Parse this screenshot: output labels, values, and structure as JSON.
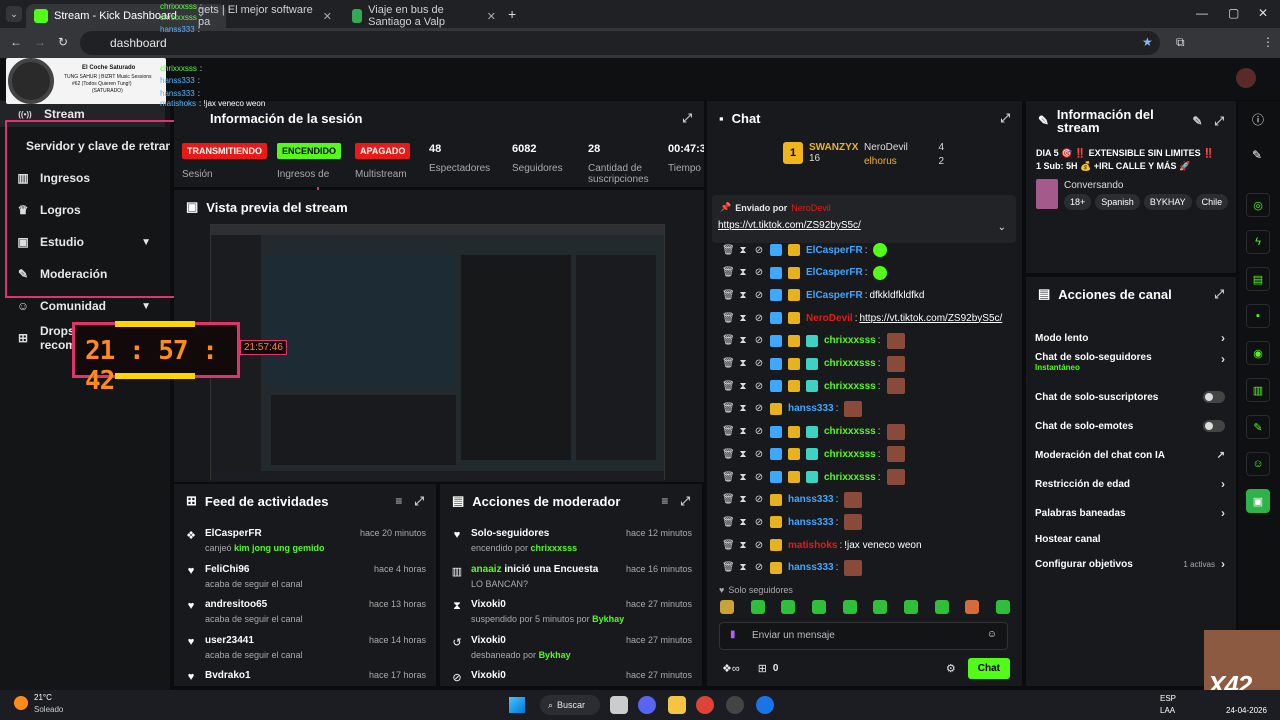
{
  "browser": {
    "tabs": [
      {
        "title": "Stream - Kick Dashboard",
        "active": true
      },
      {
        "title": "gets | El mejor software pa",
        "active": false
      },
      {
        "title": "Viaje en bus de Santiago a Valp",
        "active": false
      }
    ],
    "new_tab": "+",
    "address": "dashboard",
    "window_controls": {
      "minimize": "—",
      "maximize": "▢",
      "close": "✕"
    }
  },
  "overlay": {
    "now_playing": {
      "title": "El Coche Saturado",
      "line1": "TUNG SAHUR | BIZRT Music Sessions",
      "line2": "#62 (Todos Quieren Tung!)",
      "line3": "(SATURADO)"
    },
    "chat_lines": [
      {
        "name": "chrixxxsss",
        "green": true,
        "text": ":"
      },
      {
        "name": "chrixxxsss",
        "green": true,
        "text": ":"
      },
      {
        "name": "hanss333",
        "green": false,
        "text": ":"
      },
      {
        "name": "chrixxxsss",
        "green": true,
        "text": ":"
      },
      {
        "name": "hanss333",
        "green": false,
        "text": ":"
      },
      {
        "name": "hanss333",
        "green": false,
        "text": ":"
      },
      {
        "name": "matishoks",
        "green": false,
        "text": ": !jax veneco weon"
      }
    ],
    "timer_big": "21 : 57 : 42",
    "timer_small": "21:57:46",
    "watermark": "X42"
  },
  "sidebar": {
    "items": [
      {
        "label": "Stream",
        "icon": "broadcast-icon",
        "glyph": "((•))",
        "chevron": false
      },
      {
        "label": "Servidor y clave de retransn",
        "icon": "",
        "glyph": "",
        "chevron": false
      },
      {
        "label": "Ingresos",
        "icon": "chart-icon",
        "glyph": "▥",
        "chevron": false
      },
      {
        "label": "Logros",
        "icon": "trophy-icon",
        "glyph": "♛",
        "chevron": false
      },
      {
        "label": "Estudio",
        "icon": "studio-icon",
        "glyph": "▣",
        "chevron": true
      },
      {
        "label": "Moderación",
        "icon": "wrench-icon",
        "glyph": "✎",
        "chevron": false
      },
      {
        "label": "Comunidad",
        "icon": "community-icon",
        "glyph": "☺",
        "chevron": true
      },
      {
        "label": "Drops y recompensas",
        "icon": "gift-icon",
        "glyph": "⊞",
        "chevron": false
      }
    ]
  },
  "session": {
    "title": "Información de la sesión",
    "stats": [
      {
        "badge": "TRANSMITIENDO",
        "badge_color": "#e91916",
        "label": "Sesión"
      },
      {
        "badge": "ENCENDIDO",
        "badge_color": "#53fc18",
        "label": "Ingresos de"
      },
      {
        "badge": "APAGADO",
        "badge_color": "#e91916",
        "label": "Multistream"
      },
      {
        "value": "48",
        "label": "Espectadores"
      },
      {
        "value": "6082",
        "label": "Seguidores"
      },
      {
        "value": "28",
        "label": "Cantidad de suscripciones"
      },
      {
        "value": "00:47:3",
        "label": "Tiempo"
      }
    ]
  },
  "preview": {
    "title": "Vista previa del stream"
  },
  "feed": {
    "title": "Feed de actividades",
    "items": [
      {
        "icon": "gift-icon",
        "glyph": "❖",
        "name": "ElCasperFR",
        "time": "hace 20 minutos",
        "sub_prefix": "canjeó ",
        "sub_highlight": "kim jong ung gemido",
        "sub_suffix": ""
      },
      {
        "icon": "heart-icon",
        "glyph": "♥",
        "name": "FeliChi96",
        "time": "hace 4 horas",
        "sub_prefix": "acaba de seguir el canal",
        "sub_highlight": "",
        "sub_suffix": ""
      },
      {
        "icon": "heart-icon",
        "glyph": "♥",
        "name": "andresitoo65",
        "time": "hace 13 horas",
        "sub_prefix": "acaba de seguir el canal",
        "sub_highlight": "",
        "sub_suffix": ""
      },
      {
        "icon": "heart-icon",
        "glyph": "♥",
        "name": "user23441",
        "time": "hace 14 horas",
        "sub_prefix": "acaba de seguir el canal",
        "sub_highlight": "",
        "sub_suffix": ""
      },
      {
        "icon": "heart-icon",
        "glyph": "♥",
        "name": "Bvdrako1",
        "time": "hace 17 horas",
        "sub_prefix": "",
        "sub_highlight": "",
        "sub_suffix": ""
      }
    ]
  },
  "modactions": {
    "title": "Acciones de moderador",
    "items": [
      {
        "icon": "heart-icon",
        "glyph": "♥",
        "name": "Solo-seguidores",
        "name_hl": "",
        "time": "hace 12 minutos",
        "sub_prefix": "encendido por ",
        "sub_highlight": "chrixxxsss"
      },
      {
        "icon": "poll-icon",
        "glyph": "▥",
        "name": " inició una Encuesta",
        "name_hl": "anaaiz",
        "time": "hace 16 minutos",
        "sub_prefix": "LO BANCAN?",
        "sub_highlight": ""
      },
      {
        "icon": "hourglass-icon",
        "glyph": "⧗",
        "name": "Vixoki0",
        "name_hl": "",
        "time": "hace 27 minutos",
        "sub_prefix": "suspendido por 5 minutos por ",
        "sub_highlight": "Bykhay"
      },
      {
        "icon": "undo-icon",
        "glyph": "↺",
        "name": "Vixoki0",
        "name_hl": "",
        "time": "hace 27 minutos",
        "sub_prefix": "desbaneado por ",
        "sub_highlight": "Bykhay"
      },
      {
        "icon": "ban-icon",
        "glyph": "⊘",
        "name": "Vixoki0",
        "name_hl": "",
        "time": "hace 27 minutos",
        "sub_prefix": "",
        "sub_highlight": ""
      }
    ]
  },
  "chat": {
    "title": "Chat",
    "leaderboard": {
      "rank": "1",
      "top_name": "SWANZYX",
      "top_value": "16",
      "others": [
        {
          "name": "NeroDevil",
          "value": "4"
        },
        {
          "name": "elhorus",
          "value": "2"
        }
      ]
    },
    "pinned": {
      "label": "Enviado por",
      "by": "NeroDevil",
      "link": "https://vt.tiktok.com/ZS92byS5c/"
    },
    "messages": [
      {
        "name": "ElCasperFR",
        "color": "#3ea7ff",
        "gem": false,
        "text": "",
        "emote": "green"
      },
      {
        "name": "ElCasperFR",
        "color": "#3ea7ff",
        "gem": false,
        "text": "",
        "emote": "green"
      },
      {
        "name": "ElCasperFR",
        "color": "#3ea7ff",
        "gem": false,
        "text": "dfkkldfkldfkd",
        "emote": ""
      },
      {
        "name": "NeroDevil",
        "color": "#e91916",
        "gem": false,
        "text": "https://vt.tiktok.com/ZS92byS5c/",
        "emote": ""
      },
      {
        "name": "chrixxxsss",
        "color": "#53fc18",
        "gem": true,
        "text": "",
        "emote": "face"
      },
      {
        "name": "chrixxxsss",
        "color": "#53fc18",
        "gem": true,
        "text": "",
        "emote": "face"
      },
      {
        "name": "chrixxxsss",
        "color": "#53fc18",
        "gem": true,
        "text": "",
        "emote": "face"
      },
      {
        "name": "hanss333",
        "color": "#3ea7ff",
        "gem": false,
        "text": "",
        "emote": "face"
      },
      {
        "name": "chrixxxsss",
        "color": "#53fc18",
        "gem": true,
        "text": "",
        "emote": "face"
      },
      {
        "name": "chrixxxsss",
        "color": "#53fc18",
        "gem": true,
        "text": "",
        "emote": "face"
      },
      {
        "name": "chrixxxsss",
        "color": "#53fc18",
        "gem": true,
        "text": "",
        "emote": "face"
      },
      {
        "name": "hanss333",
        "color": "#3ea7ff",
        "gem": false,
        "text": "",
        "emote": "face"
      },
      {
        "name": "hanss333",
        "color": "#3ea7ff",
        "gem": false,
        "text": "",
        "emote": "face"
      },
      {
        "name": "matishoks",
        "color": "#e91916",
        "gem": false,
        "text": "!jax veneco weon",
        "emote": ""
      },
      {
        "name": "hanss333",
        "color": "#3ea7ff",
        "gem": false,
        "text": "",
        "emote": "face"
      }
    ],
    "mode_label": "Solo seguidores",
    "input_placeholder": "Enviar un mensaje",
    "points": "0",
    "send_label": "Chat"
  },
  "stream_info": {
    "title": "Información del stream",
    "stream_title_line1": "DIA 5 🎯 ‼️ EXTENSIBLE SIN LIMITES ‼️",
    "stream_title_line2": "1 Sub: 5H 💰 +IRL CALLE Y MÁS 🚀",
    "category": "Conversando",
    "tags": [
      "18+",
      "Spanish",
      "BYKHAY",
      "Chile"
    ]
  },
  "channel_actions": {
    "title": "Acciones de canal",
    "items": [
      {
        "label": "Modo lento",
        "sub": "",
        "control": "arrow"
      },
      {
        "label": "Chat de solo-seguidores",
        "sub": "Instantáneo",
        "control": "arrow"
      },
      {
        "label": "Chat de solo-suscriptores",
        "sub": "",
        "control": "toggle"
      },
      {
        "label": "Chat de solo-emotes",
        "sub": "",
        "control": "toggle"
      },
      {
        "label": "Moderación del chat con IA",
        "sub": "",
        "control": "external"
      },
      {
        "label": "Restricción de edad",
        "sub": "",
        "control": "arrow"
      },
      {
        "label": "Palabras baneadas",
        "sub": "",
        "control": "arrow"
      },
      {
        "label": "Hostear canal",
        "sub": "",
        "control": "none"
      },
      {
        "label": "Configurar objetivos",
        "sub": "1 activas",
        "control": "arrow"
      }
    ]
  },
  "taskbar": {
    "weather_temp": "21°C",
    "weather_desc": "Soleado",
    "search_label": "Buscar",
    "lang_top": "ESP",
    "lang_bottom": "LAA",
    "time": "08",
    "date": "24-04-2026"
  },
  "colors": {
    "kick_green": "#53fc18",
    "live_red": "#e91916",
    "highlight_pink": "#e0336b",
    "timer_orange": "#ff8c1a"
  }
}
